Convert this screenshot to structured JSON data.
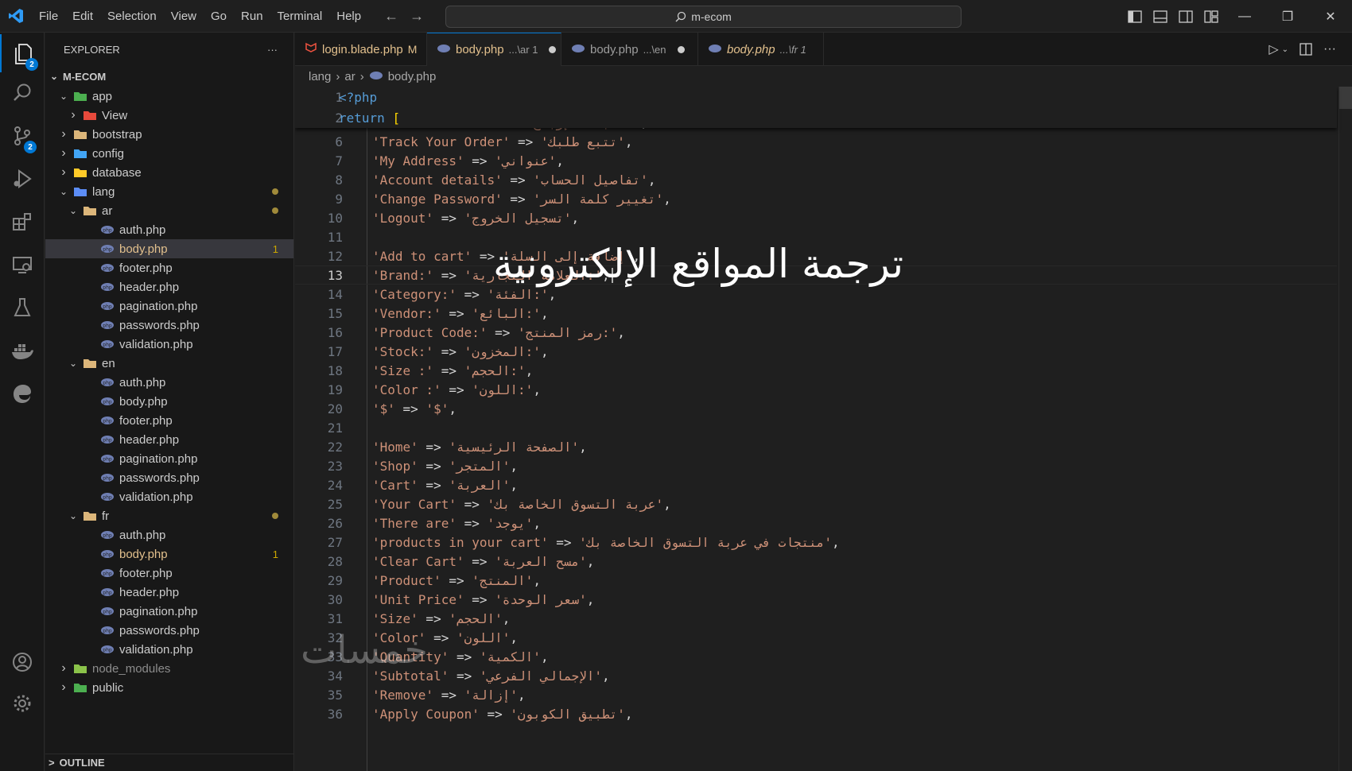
{
  "titlebar": {
    "menu": [
      "File",
      "Edit",
      "Selection",
      "View",
      "Go",
      "Run",
      "Terminal",
      "Help"
    ],
    "search_text": "m-ecom"
  },
  "activity": {
    "explorer_badge": "2",
    "scm_badge": "2"
  },
  "sidebar": {
    "title": "EXPLORER",
    "more": "···",
    "root": "M-ECOM",
    "outline": "OUTLINE",
    "rows": [
      {
        "label": "app",
        "indent": 1,
        "chev": "v",
        "type": "folder-app"
      },
      {
        "label": "View",
        "indent": 2,
        "chev": ">",
        "type": "folder-view"
      },
      {
        "label": "bootstrap",
        "indent": 1,
        "chev": ">",
        "type": "folder"
      },
      {
        "label": "config",
        "indent": 1,
        "chev": ">",
        "type": "folder-config"
      },
      {
        "label": "database",
        "indent": 1,
        "chev": ">",
        "type": "folder-db"
      },
      {
        "label": "lang",
        "indent": 1,
        "chev": "v",
        "type": "folder-lang",
        "dot": true
      },
      {
        "label": "ar",
        "indent": 2,
        "chev": "v",
        "type": "folder-open",
        "dot": true
      },
      {
        "label": "auth.php",
        "indent": 3,
        "type": "php"
      },
      {
        "label": "body.php",
        "indent": 3,
        "type": "php",
        "selected": true,
        "modified": true,
        "count": "1"
      },
      {
        "label": "footer.php",
        "indent": 3,
        "type": "php"
      },
      {
        "label": "header.php",
        "indent": 3,
        "type": "php"
      },
      {
        "label": "pagination.php",
        "indent": 3,
        "type": "php"
      },
      {
        "label": "passwords.php",
        "indent": 3,
        "type": "php"
      },
      {
        "label": "validation.php",
        "indent": 3,
        "type": "php"
      },
      {
        "label": "en",
        "indent": 2,
        "chev": "v",
        "type": "folder-open"
      },
      {
        "label": "auth.php",
        "indent": 3,
        "type": "php"
      },
      {
        "label": "body.php",
        "indent": 3,
        "type": "php"
      },
      {
        "label": "footer.php",
        "indent": 3,
        "type": "php"
      },
      {
        "label": "header.php",
        "indent": 3,
        "type": "php"
      },
      {
        "label": "pagination.php",
        "indent": 3,
        "type": "php"
      },
      {
        "label": "passwords.php",
        "indent": 3,
        "type": "php"
      },
      {
        "label": "validation.php",
        "indent": 3,
        "type": "php"
      },
      {
        "label": "fr",
        "indent": 2,
        "chev": "v",
        "type": "folder-open",
        "dot": true
      },
      {
        "label": "auth.php",
        "indent": 3,
        "type": "php"
      },
      {
        "label": "body.php",
        "indent": 3,
        "type": "php",
        "modified": true,
        "count": "1"
      },
      {
        "label": "footer.php",
        "indent": 3,
        "type": "php"
      },
      {
        "label": "header.php",
        "indent": 3,
        "type": "php"
      },
      {
        "label": "pagination.php",
        "indent": 3,
        "type": "php"
      },
      {
        "label": "passwords.php",
        "indent": 3,
        "type": "php"
      },
      {
        "label": "validation.php",
        "indent": 3,
        "type": "php"
      },
      {
        "label": "node_modules",
        "indent": 1,
        "chev": ">",
        "type": "folder-node",
        "dim": true
      },
      {
        "label": "public",
        "indent": 1,
        "chev": ">",
        "type": "folder-public"
      }
    ]
  },
  "tabs": [
    {
      "label": "login.blade.php",
      "desc": "",
      "mod": "M",
      "icon": "blade"
    },
    {
      "label": "body.php",
      "desc": "...\\ar 1",
      "dirty": true,
      "active": true,
      "icon": "php"
    },
    {
      "label": "body.php",
      "desc": "...\\en",
      "dirty": true,
      "icon": "php"
    },
    {
      "label": "body.php",
      "desc": "...\\fr 1",
      "italic": true,
      "icon": "php"
    }
  ],
  "breadcrumb": [
    "lang",
    "ar",
    "body.php"
  ],
  "editor": {
    "current_line": 13,
    "sticky": [
      {
        "n": 1,
        "code": [
          [
            "kw",
            "<?php"
          ]
        ]
      },
      {
        "n": 2,
        "code": [
          [
            "kw",
            "return"
          ],
          [
            "op",
            " "
          ],
          [
            "br",
            "["
          ]
        ]
      }
    ],
    "lines": [
      {
        "n": 5,
        "key": "'Return Orders:'",
        "val": "'طلبات الإرجاع:'"
      },
      {
        "n": 6,
        "key": "'Track Your Order'",
        "val": "'تتبع طلبك'"
      },
      {
        "n": 7,
        "key": "'My Address'",
        "val": "'عنواني'"
      },
      {
        "n": 8,
        "key": "'Account details'",
        "val": "'تفاصيل الحساب'"
      },
      {
        "n": 9,
        "key": "'Change Password'",
        "val": "'تغيير كلمة السر'"
      },
      {
        "n": 10,
        "key": "'Logout'",
        "val": "'تسجيل الخروج'"
      },
      {
        "n": 11,
        "key": "",
        "val": ""
      },
      {
        "n": 12,
        "key": "'Add to cart'",
        "val": "'إضافة إلى السلة'"
      },
      {
        "n": 13,
        "key": "'Brand:'",
        "val": "'العلامة التجارية:'"
      },
      {
        "n": 14,
        "key": "'Category:'",
        "val": "'الفئة:'"
      },
      {
        "n": 15,
        "key": "'Vendor:'",
        "val": "'البائع:'"
      },
      {
        "n": 16,
        "key": "'Product Code:'",
        "val": "'رمز المنتج:'"
      },
      {
        "n": 17,
        "key": "'Stock:'",
        "val": "'المخزون:'"
      },
      {
        "n": 18,
        "key": "'Size :'",
        "val": "'الحجم:'"
      },
      {
        "n": 19,
        "key": "'Color :'",
        "val": "'اللون:'"
      },
      {
        "n": 20,
        "key": "'$'",
        "val": "'$'"
      },
      {
        "n": 21,
        "key": "",
        "val": ""
      },
      {
        "n": 22,
        "key": "'Home'",
        "val": "'الصفحة الرئيسية'"
      },
      {
        "n": 23,
        "key": "'Shop'",
        "val": "'المتجر'"
      },
      {
        "n": 24,
        "key": "'Cart'",
        "val": "'العربة'"
      },
      {
        "n": 25,
        "key": "'Your Cart'",
        "val": "'عربة التسوق الخاصة بك'"
      },
      {
        "n": 26,
        "key": "'There are'",
        "val": "'يوجد'"
      },
      {
        "n": 27,
        "key": "'products in your cart'",
        "val": "'منتجات في عربة التسوق الخاصة بك'"
      },
      {
        "n": 28,
        "key": "'Clear Cart'",
        "val": "'مسح العربة'"
      },
      {
        "n": 29,
        "key": "'Product'",
        "val": "'المنتج'"
      },
      {
        "n": 30,
        "key": "'Unit Price'",
        "val": "'سعر الوحدة'"
      },
      {
        "n": 31,
        "key": "'Size'",
        "val": "'الحجم'"
      },
      {
        "n": 32,
        "key": "'Color'",
        "val": "'اللون'"
      },
      {
        "n": 33,
        "key": "'Quantity'",
        "val": "'الكمية'"
      },
      {
        "n": 34,
        "key": "'Subtotal'",
        "val": "'الإجمالي الفرعي'"
      },
      {
        "n": 35,
        "key": "'Remove'",
        "val": "'إزالة'"
      },
      {
        "n": 36,
        "key": "'Apply Coupon'",
        "val": "'تطبيق الكوبون'"
      }
    ]
  },
  "overlay": {
    "caption": "ترجمة المواقع الإلكترونية",
    "watermark": "خمسات"
  },
  "colors": {
    "accent": "#0078d4",
    "keyword": "#569cd6",
    "string": "#ce9178",
    "bracket": "#ffd700",
    "modified": "#e2c08d"
  }
}
